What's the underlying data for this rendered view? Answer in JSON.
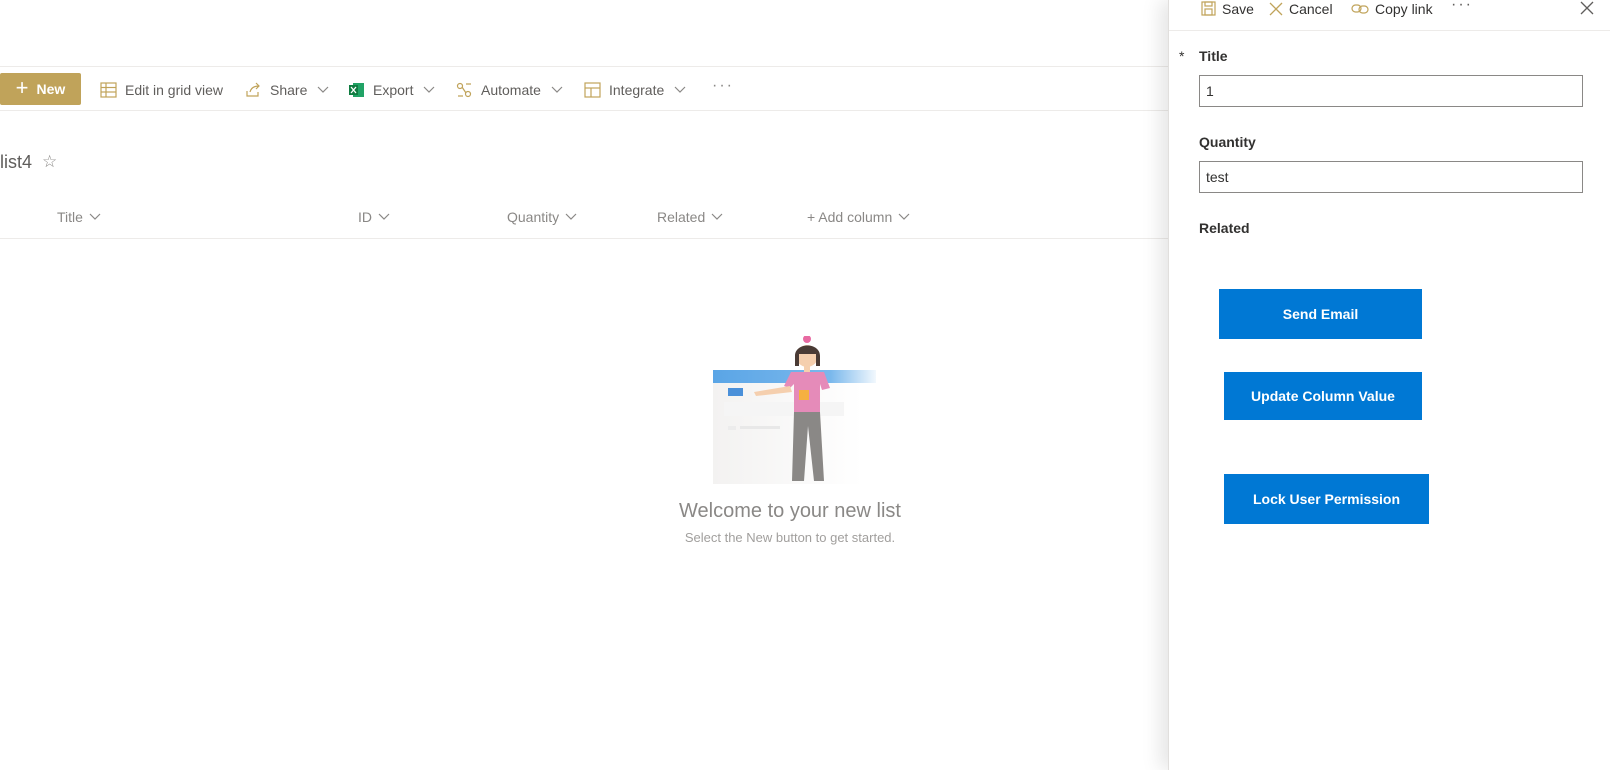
{
  "toolbar": {
    "new_label": "New",
    "edit_grid_label": "Edit in grid view",
    "share_label": "Share",
    "export_label": "Export",
    "automate_label": "Automate",
    "integrate_label": "Integrate",
    "more_label": "···"
  },
  "list": {
    "title": "list4",
    "favorite_icon": "☆",
    "columns": [
      {
        "label": "Title"
      },
      {
        "label": "ID"
      },
      {
        "label": "Quantity"
      },
      {
        "label": "Related"
      },
      {
        "label": "+ Add column"
      }
    ],
    "empty_title": "Welcome to your new list",
    "empty_subtitle": "Select the New button to get started."
  },
  "panel": {
    "save_label": "Save",
    "cancel_label": "Cancel",
    "copy_link_label": "Copy link",
    "more_label": "···",
    "required_marker": "*",
    "fields": [
      {
        "label": "Title",
        "value": "1"
      },
      {
        "label": "Quantity",
        "value": "test"
      },
      {
        "label": "Related"
      }
    ],
    "buttons": [
      {
        "label": "Send Email"
      },
      {
        "label": "Update Column Value"
      },
      {
        "label": "Lock User Permission"
      }
    ]
  },
  "colors": {
    "brand": "#c0a35a",
    "primary_button": "#0078d4",
    "excel_green": "#107c41"
  }
}
